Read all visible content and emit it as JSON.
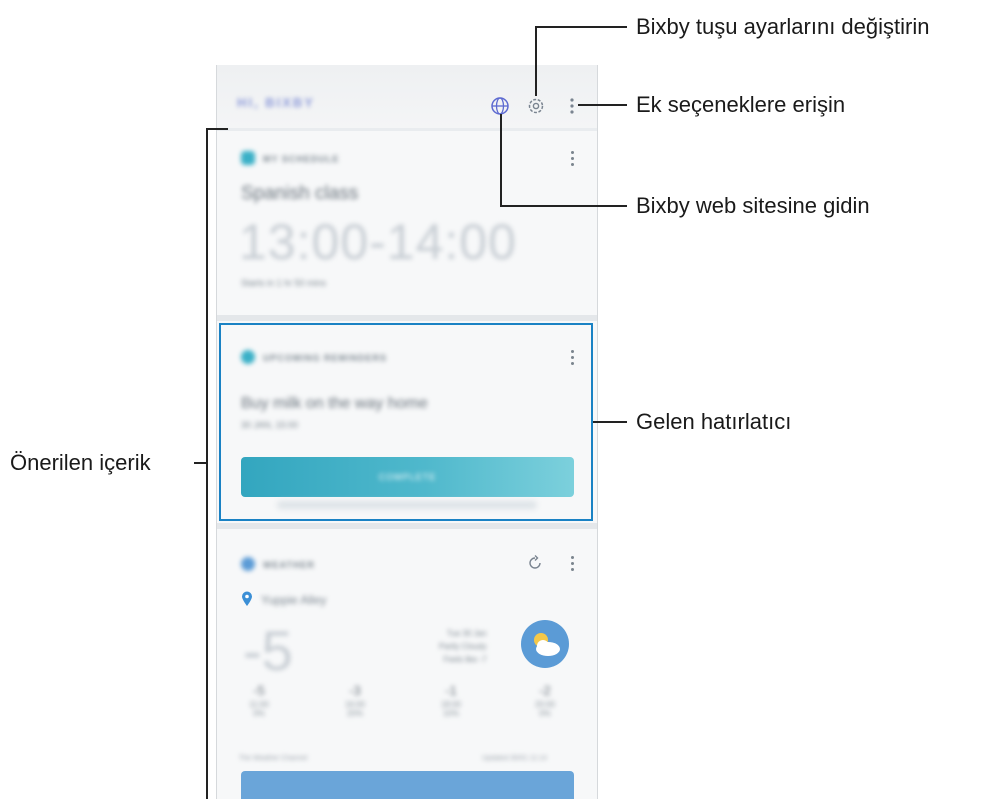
{
  "callouts": {
    "bixby_key_settings": "Bixby tuşu ayarlarını değiştirin",
    "more_options": "Ek seçeneklere erişin",
    "bixby_website": "Bixby web sitesine gidin",
    "incoming_reminder": "Gelen hatırlatıcı",
    "suggested_content": "Önerilen içerik"
  },
  "app": {
    "brand": "HI, BIXBY"
  },
  "cards": {
    "schedule": {
      "header": "MY SCHEDULE",
      "title": "Spanish class",
      "time": "13:00-14:00",
      "note": "Starts in 1 hr 50 mins"
    },
    "reminder": {
      "header": "UPCOMING REMINDERS",
      "title": "Buy milk on the way home",
      "date": "30 JAN, 15:00",
      "button": "COMPLETE"
    },
    "weather": {
      "header": "WEATHER",
      "location": "Yuppie Alley",
      "temp": "-5",
      "desc_line1": "Tue 30 Jan",
      "desc_line2": "Partly Cloudy",
      "desc_line3": "Feels like -7",
      "forecast": [
        {
          "temp": "-5",
          "hour": "11:00",
          "precip": "0%"
        },
        {
          "temp": "-3",
          "hour": "16:00",
          "precip": "20%"
        },
        {
          "temp": "-1",
          "hour": "18:00",
          "precip": "10%"
        },
        {
          "temp": "-2",
          "hour": "20:00",
          "precip": "0%"
        }
      ],
      "footer_left": "The Weather Channel",
      "footer_right": "Updated 30/01 11:14"
    }
  },
  "colors": {
    "accent": "#3ab0c7",
    "highlight_border": "#1a82c4",
    "weather_blue": "#5b9bd6"
  }
}
